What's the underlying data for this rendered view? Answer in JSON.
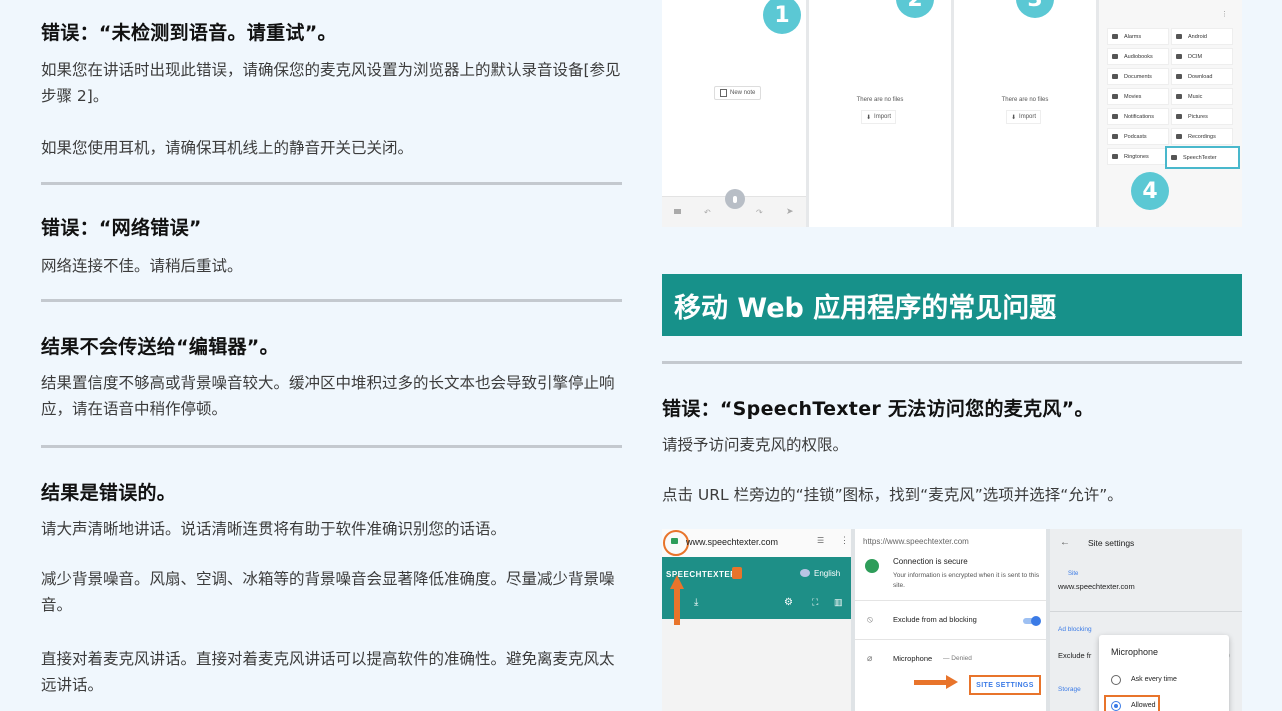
{
  "left": {
    "sections": [
      {
        "title": "错误：“未检测到语音。请重试”。",
        "paras": [
          "如果您在讲话时出现此错误，请确保您的麦克风设置为浏览器上的默认录音设备[参见步骤 2]。",
          "如果您使用耳机，请确保耳机线上的静音开关已关闭。"
        ]
      },
      {
        "title": "错误：“网络错误”",
        "paras": [
          "网络连接不佳。请稍后重试。"
        ]
      },
      {
        "title": "结果不会传送给“编辑器”。",
        "paras": [
          "结果置信度不够高或背景噪音较大。缓冲区中堆积过多的长文本也会导致引擎停止响应，请在语音中稍作停顿。"
        ]
      },
      {
        "title": "结果是错误的。",
        "paras": [
          "请大声清晰地讲话。说话清晰连贯将有助于软件准确识别您的话语。",
          "减少背景噪音。风扇、空调、冰箱等的背景噪音会显著降低准确度。尽量减少背景噪音。",
          "直接对着麦克风讲话。直接对着麦克风讲话可以提高软件的准确性。避免离麦克风太远讲话。"
        ]
      }
    ]
  },
  "right": {
    "top_shot": {
      "steps": [
        "1",
        "2",
        "3",
        "4"
      ],
      "new_note": "New note",
      "no_files": "There are no files",
      "import": "Import",
      "folders": [
        "Alarms",
        "Android",
        "Audiobooks",
        "DCIM",
        "Documents",
        "Download",
        "Movies",
        "Music",
        "Notifications",
        "Pictures",
        "Podcasts",
        "Recordings",
        "Ringtones",
        "SpeechTexter"
      ]
    },
    "section_heading": "移动 Web 应用程序的常见问题",
    "error_title": "错误：“SpeechTexter 无法访问您的麦克风”。",
    "para1": "请授予访问麦克风的权限。",
    "para2": "点击 URL 栏旁边的“挂锁”图标，找到“麦克风”选项并选择“允许”。",
    "bottom_shot": {
      "url": "www.speechtexter.com",
      "brand": "SPEECHTEXTER",
      "lang": "English",
      "popup_url": "https://www.speechtexter.com",
      "secure_title": "Connection is secure",
      "secure_body": "Your information is encrypted when it is sent to this site.",
      "ad_exclude": "Exclude from ad blocking",
      "mic_label": "Microphone",
      "mic_state": "— Denied",
      "site_settings_btn": "SITE SETTINGS",
      "site_settings_title": "Site settings",
      "site_label": "Site",
      "site_url": "www.speechtexter.com",
      "ad_blocking": "Ad blocking",
      "exclude_fr": "Exclude fr",
      "storage": "Storage",
      "mic_dialog_title": "Microphone",
      "ask_every_time": "Ask every time",
      "allowed": "Allowed"
    }
  }
}
